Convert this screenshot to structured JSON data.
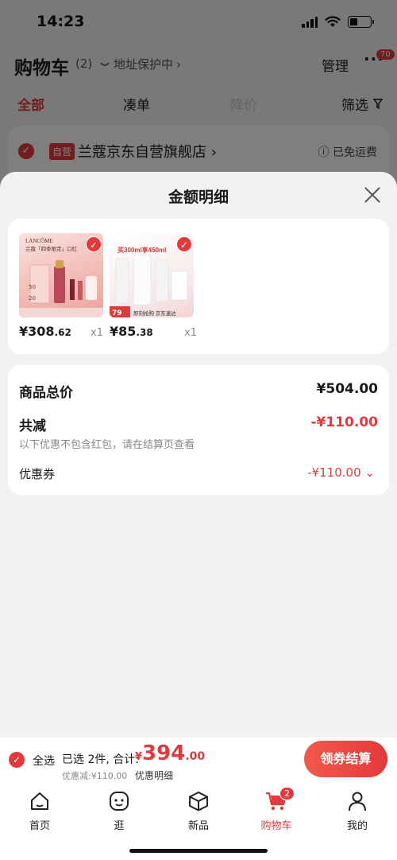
{
  "status_bar": {
    "time": "14:23"
  },
  "header": {
    "title": "购物车",
    "count": "(2)",
    "address_protect": "地址保护中",
    "manage": "管理",
    "more": "···",
    "more_badge": "70"
  },
  "filter_tabs": [
    "全部",
    "凑单",
    "降价",
    "筛选"
  ],
  "store": {
    "tag": "自营",
    "name": "兰蔻京东自营旗舰店 ›",
    "shipping": "已免运费"
  },
  "sheet": {
    "title": "金额明细",
    "products": [
      {
        "price_int": "¥308",
        "price_dec": ".62",
        "qty": "x1",
        "thumb_texts": [
          "LANCÔME",
          "兰蔻「四季限定」口红",
          "50",
          "20"
        ]
      },
      {
        "price_int": "¥85",
        "price_dec": ".38",
        "qty": "x1",
        "thumb_texts": [
          "买300ml享450ml",
          "79",
          "即刻抢购 京东速达"
        ]
      }
    ],
    "detail": {
      "total_label": "商品总价",
      "total_value": "¥504.00",
      "reduce_label": "共减",
      "reduce_value": "-¥110.00",
      "note": "以下优惠不包含红包，请在结算页查看",
      "coupon_label": "优惠券",
      "coupon_value": "-¥110.00"
    }
  },
  "checkout": {
    "select_all": "全选",
    "selected": "已选 2件, 合计:",
    "currency": "¥",
    "total_int": "394",
    "total_dec": ".00",
    "discount": "优惠减:¥110.00",
    "detail_link": "优惠明细",
    "button": "领券结算"
  },
  "tabbar": {
    "items": [
      "首页",
      "逛",
      "新品",
      "购物车",
      "我的"
    ],
    "cart_badge": "2"
  },
  "colors": {
    "accent": "#e4393c"
  }
}
